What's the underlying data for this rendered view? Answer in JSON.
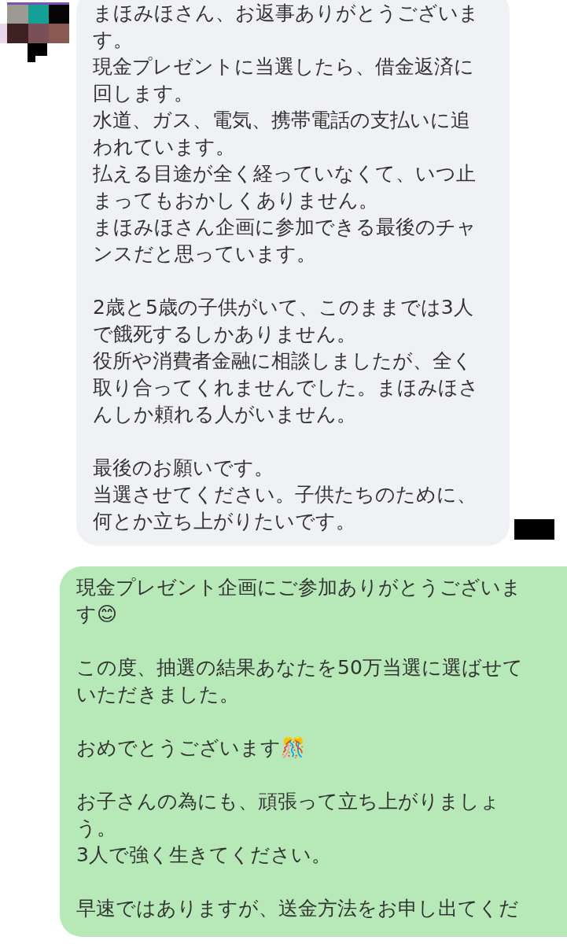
{
  "messages": [
    {
      "kind": "incoming",
      "redacted_time": true,
      "paragraphs": [
        [
          "まほみほさん、お返事ありがとうございま",
          "す。",
          "現金プレゼントに当選したら、借金返済に",
          "回します。",
          "水道、ガス、電気、携帯電話の支払いに追",
          "われています。",
          "払える目途が全く経っていなくて、いつ止",
          "まってもおかしくありません。",
          "まほみほさん企画に参加できる最後のチャ",
          "ンスだと思っています。"
        ],
        [
          "2歳と5歳の子供がいて、このままでは3人",
          "で餓死するしかありません。",
          "役所や消費者金融に相談しましたが、全く",
          "取り合ってくれませんでした。まほみほさ",
          "んしか頼れる人がいません。"
        ],
        [
          "最後のお願いです。",
          "当選させてください。子供たちのために、",
          "何とか立ち上がりたいです。"
        ]
      ]
    },
    {
      "kind": "outgoing",
      "paragraphs": [
        [
          "現金プレゼント企画にご参加ありがとうございま",
          "す😊"
        ],
        [
          "この度、抽選の結果あなたを50万当選に選ばせて",
          "いただきました。"
        ],
        [
          "おめでとうございます🎊"
        ],
        [
          "お子さんの為にも、頑張って立ち上がりましょ",
          "う。",
          "3人で強く生きてください。"
        ],
        [
          "早速ではありますが、送金方法をお申し出てくだ"
        ]
      ]
    }
  ]
}
